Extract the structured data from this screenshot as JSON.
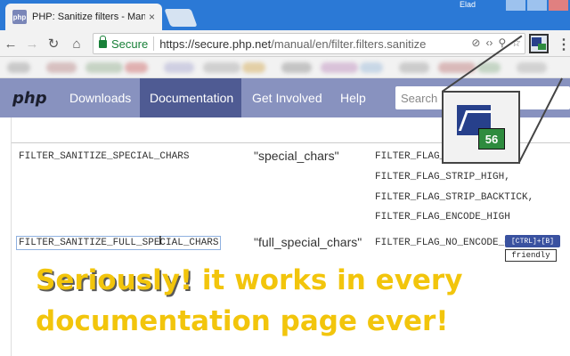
{
  "browser": {
    "tab_title": "PHP: Sanitize filters - Manu",
    "tab_favicon_text": "php",
    "tab_close": "×",
    "profile_name": "Elad",
    "secure_label": "Secure",
    "url_scheme": "https://",
    "url_host": "secure.php.net",
    "url_path": "/manual/en/filter.filters.sanitize",
    "back_glyph": "←",
    "forward_glyph": "→",
    "reload_glyph": "↻",
    "home_glyph": "⌂",
    "menu_glyph": "⋮",
    "omnibox_icons": [
      "⊘",
      "‹›",
      "⚲",
      "☆"
    ]
  },
  "bookmarks_colors": [
    "#c9c9c9",
    "#d7c0c0",
    "#c6d3c4",
    "#e0b0b0",
    "#cfcfe2",
    "#d0d0d0",
    "#e3cfa6",
    "#c4c4c4",
    "#d9c2d9",
    "#c8d7e6",
    "#cccccc",
    "#d9b9b9",
    "#c5d5c5",
    "#d2d2d2"
  ],
  "php_nav": {
    "logo": "php",
    "links": [
      {
        "label": "Downloads",
        "active": false
      },
      {
        "label": "Documentation",
        "active": true
      },
      {
        "label": "Get Involved",
        "active": false
      },
      {
        "label": "Help",
        "active": false
      }
    ],
    "search_placeholder": "Search"
  },
  "table": {
    "rows": [
      {
        "id": "FILTER_SANITIZE_SPECIAL_CHARS",
        "name": "\"special_chars\"",
        "flags": [
          "FILTER_FLAG_STRIP_LOW,",
          "FILTER_FLAG_STRIP_HIGH,",
          "FILTER_FLAG_STRIP_BACKTICK,",
          "FILTER_FLAG_ENCODE_HIGH"
        ]
      },
      {
        "id": "FILTER_SANITIZE_FULL_SPECIAL_CHARS",
        "name": "\"full_special_chars\"",
        "flags": [
          "FILTER_FLAG_NO_ENCODE_QUOTES"
        ]
      }
    ]
  },
  "cursor_glyph": "I",
  "extension_badge": {
    "number": "56",
    "shortcut": "[CTRL]+[B]",
    "label": "friendly"
  },
  "promo": {
    "line1_highlight": "Seriously!",
    "line1_rest": "it works in every",
    "line2": "documentation page ever!"
  },
  "colors": {
    "php_nav_bg": "#8892bf",
    "php_nav_active": "#4f5b93",
    "promo_text": "#f2c50c",
    "secure_green": "#188038",
    "chrome_blue": "#2b79d6"
  }
}
